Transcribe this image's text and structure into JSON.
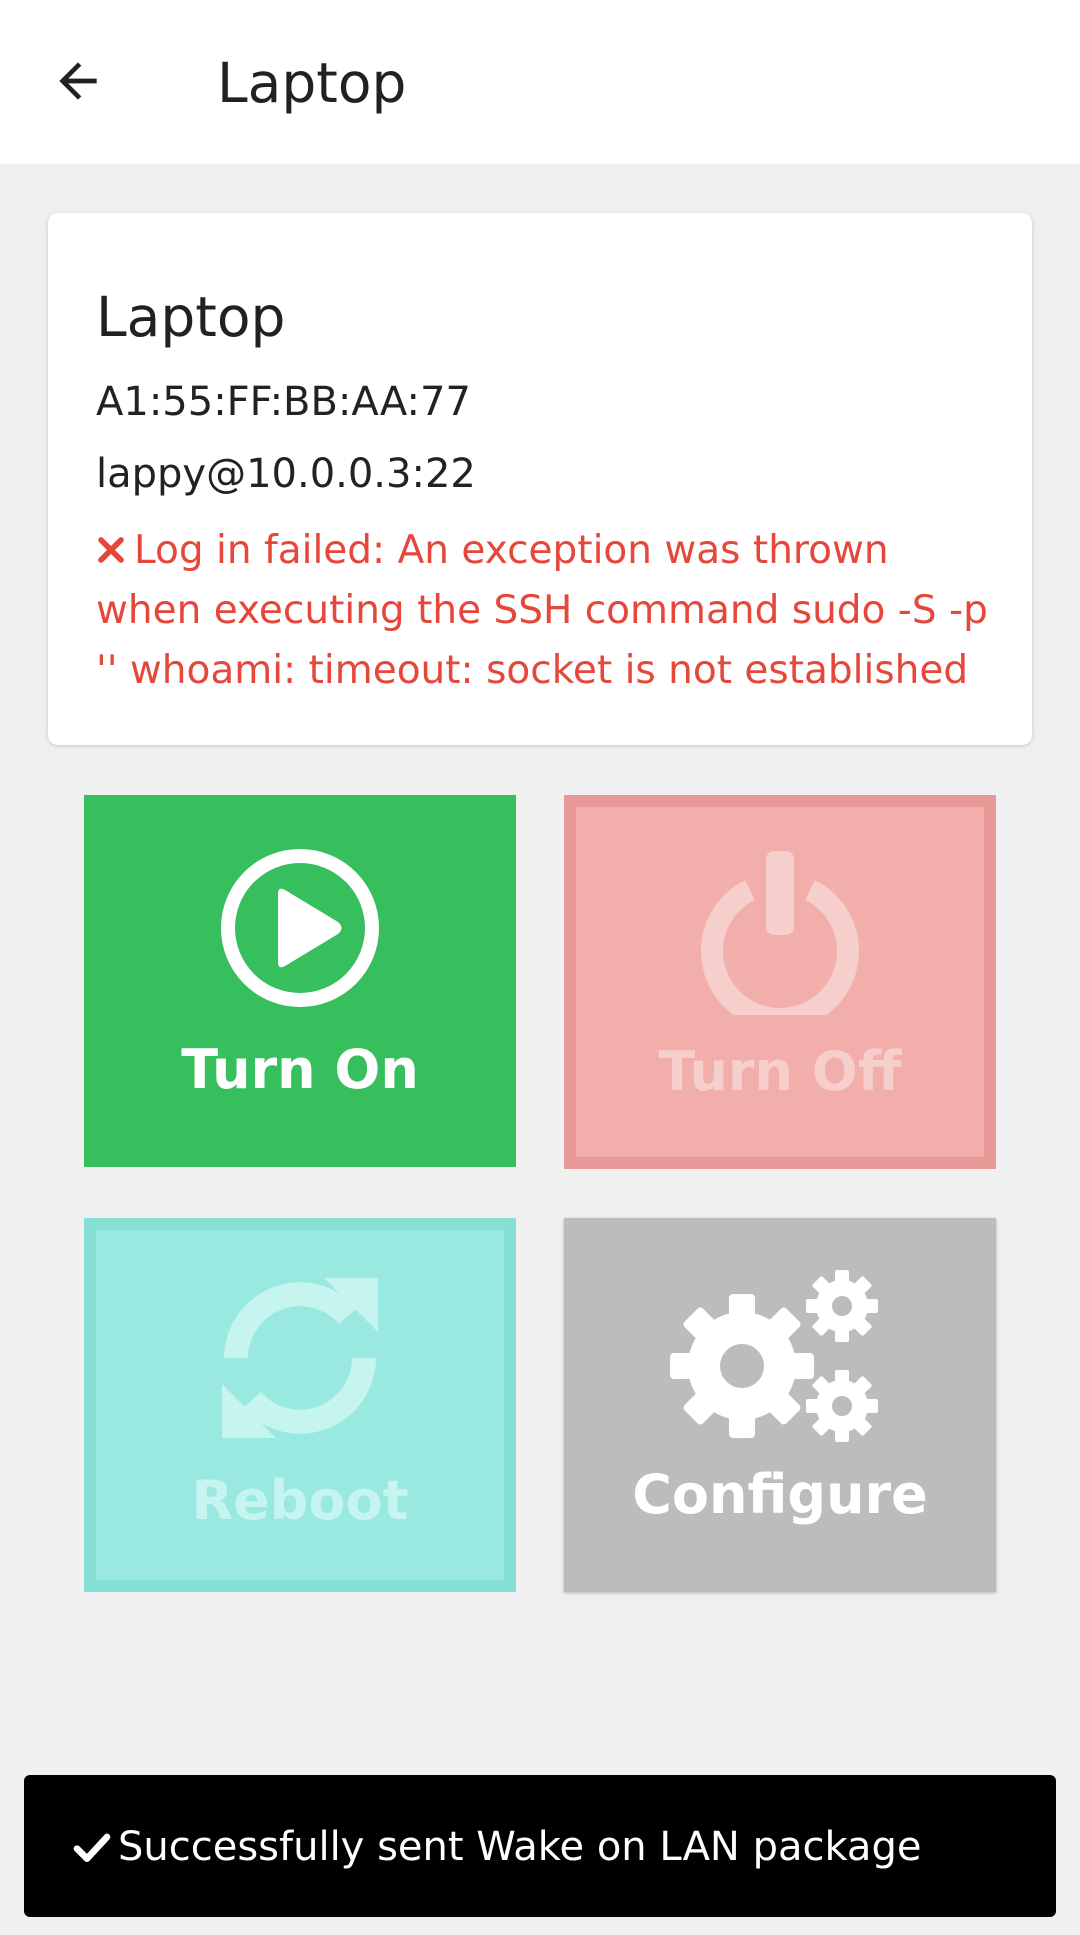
{
  "header": {
    "title": "Laptop",
    "back_icon": "arrow-left-icon"
  },
  "device": {
    "name": "Laptop",
    "mac": "A1:55:FF:BB:AA:77",
    "ssh": "lappy@10.0.0.3:22",
    "error_icon": "close-icon",
    "error_message": "Log in failed: An exception was thrown when executing the SSH command sudo -S -p '' whoami: timeout: socket is not established",
    "error_color": "#e5473b"
  },
  "actions": {
    "turn_on": {
      "label": "Turn On",
      "icon": "play-circle-icon",
      "color": "#37bf5d",
      "enabled": true
    },
    "turn_off": {
      "label": "Turn Off",
      "icon": "power-icon",
      "color": "#f1aeaa",
      "enabled": false
    },
    "reboot": {
      "label": "Reboot",
      "icon": "refresh-icon",
      "color": "#99e9e0",
      "enabled": false
    },
    "configure": {
      "label": "Configure",
      "icon": "gears-icon",
      "color": "#bcbcbc",
      "enabled": true
    }
  },
  "snackbar": {
    "icon": "check-icon",
    "message": "Successfully sent Wake on LAN package"
  }
}
